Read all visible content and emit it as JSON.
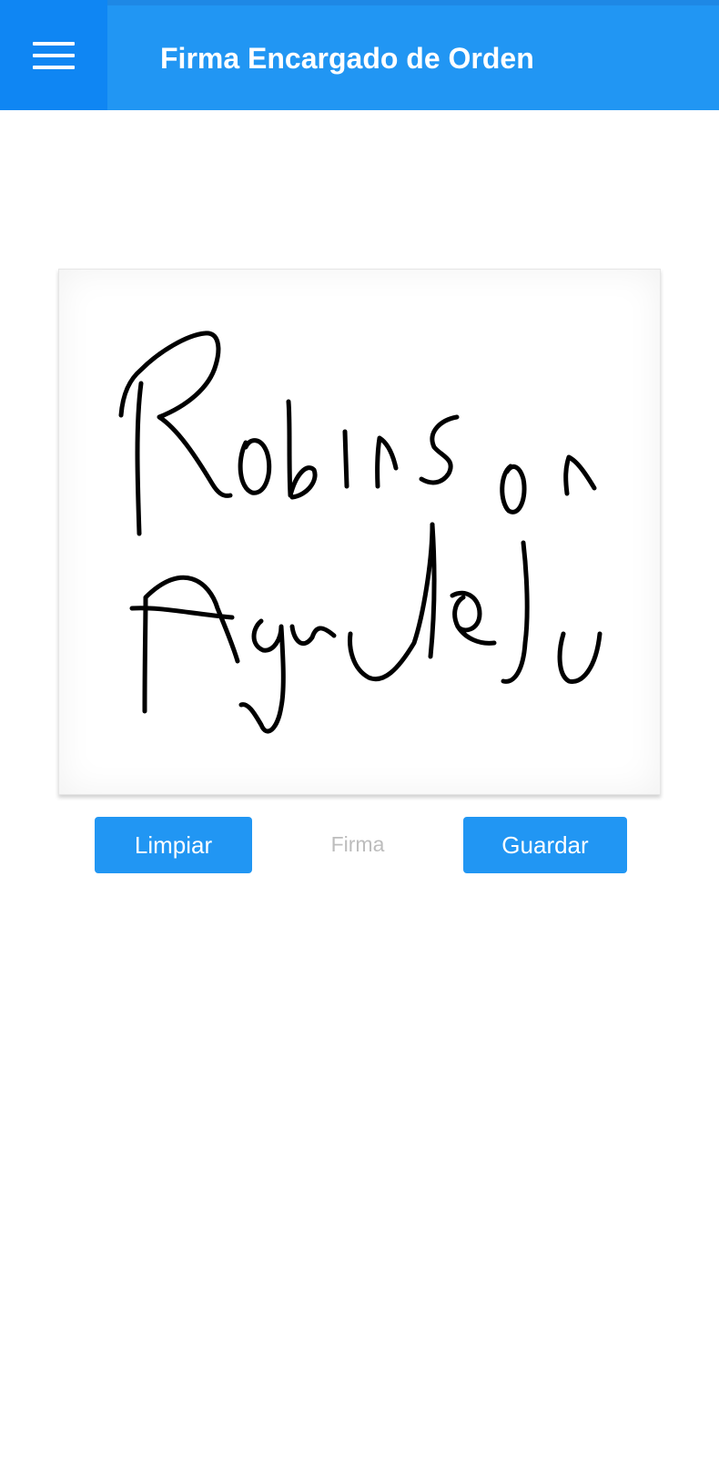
{
  "app_bar": {
    "title": "Firma Encargado de Orden",
    "menu_icon": "hamburger-menu-icon",
    "background_color": "#2196F3"
  },
  "signature_pad": {
    "caption": "Firma",
    "signature_text": "Robinson Agudelo"
  },
  "actions": {
    "clear_label": "Limpiar",
    "save_label": "Guardar",
    "button_color": "#2196F3"
  }
}
